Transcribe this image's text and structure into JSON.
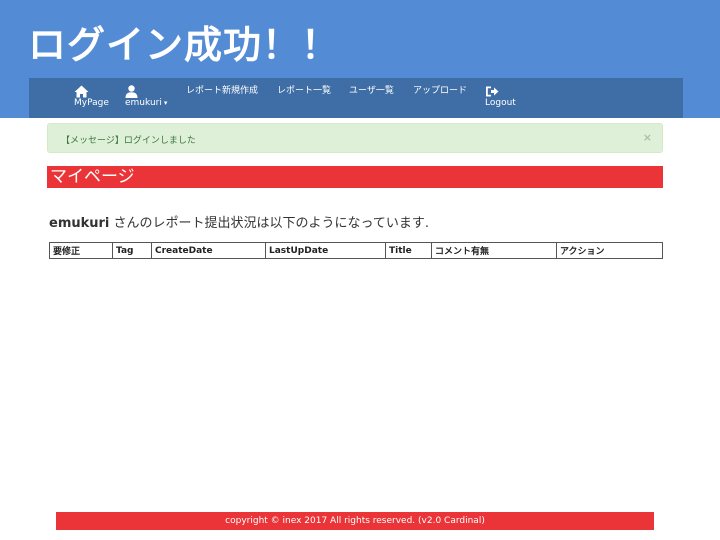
{
  "slide": {
    "title": "ログイン成功！！"
  },
  "navbar": {
    "items": [
      {
        "label": "MyPage",
        "icon": "home-icon"
      },
      {
        "label": "emukuri",
        "icon": "user-icon",
        "caret": "▾"
      },
      {
        "label": "レポート新規作成"
      },
      {
        "label": "レポート一覧"
      },
      {
        "label": "ユーザ一覧"
      },
      {
        "label": "アップロード"
      },
      {
        "label": "Logout",
        "icon": "sign-out-icon"
      }
    ]
  },
  "alert": {
    "text": "【メッセージ】ログインしました",
    "close": "×"
  },
  "page": {
    "heading": "マイページ"
  },
  "status": {
    "user": "emukuri",
    "text": " さんのレポート提出状況は以下のようになっています."
  },
  "table": {
    "headers": [
      "要修正",
      "Tag",
      "CreateDate",
      "LastUpDate",
      "Title",
      "コメント有無",
      "アクション"
    ]
  },
  "footer": {
    "text": "copyright © inex 2017 All rights reserved. (v2.0 Cardinal)"
  },
  "colors": {
    "header": "#538cd4",
    "navbar": "#3f6ea6",
    "accent": "#ea3438",
    "alert_bg": "#dff0d8",
    "alert_text": "#3c763d"
  }
}
